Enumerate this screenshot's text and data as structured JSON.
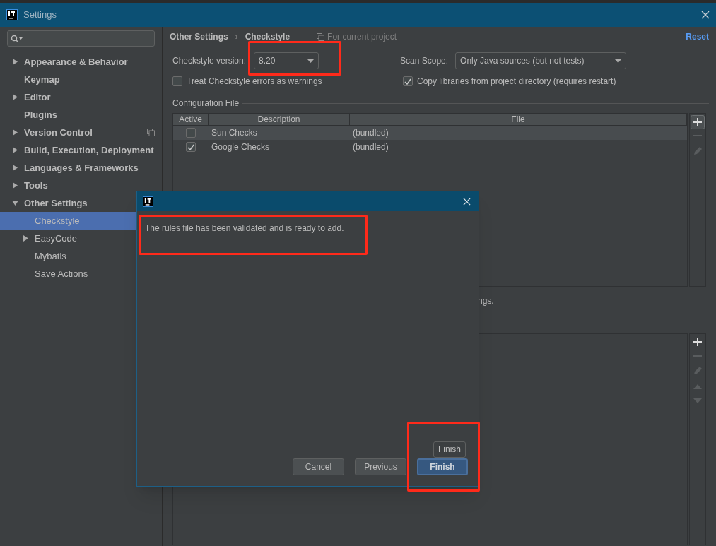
{
  "window": {
    "title": "Settings"
  },
  "sidebar": {
    "items": [
      {
        "label": "Appearance & Behavior",
        "expanded": false,
        "selected": false
      },
      {
        "label": "Keymap",
        "selected": false
      },
      {
        "label": "Editor",
        "expanded": false,
        "selected": false
      },
      {
        "label": "Plugins",
        "selected": false
      },
      {
        "label": "Version Control",
        "expanded": false,
        "selected": false,
        "project_scoped": true
      },
      {
        "label": "Build, Execution, Deployment",
        "expanded": false,
        "selected": false
      },
      {
        "label": "Languages & Frameworks",
        "expanded": false,
        "selected": false
      },
      {
        "label": "Tools",
        "expanded": false,
        "selected": false
      },
      {
        "label": "Other Settings",
        "expanded": true,
        "selected": false,
        "children": [
          {
            "label": "Checkstyle",
            "selected": true
          },
          {
            "label": "EasyCode",
            "expanded": false,
            "selected": false
          },
          {
            "label": "Mybatis",
            "selected": false
          },
          {
            "label": "Save Actions",
            "selected": false
          }
        ]
      }
    ]
  },
  "breadcrumb": [
    "Other Settings",
    "Checkstyle"
  ],
  "breadcrumb_separator": "›",
  "scope_note": "For current project",
  "reset_link": "Reset",
  "version": {
    "label": "Checkstyle version:",
    "value": "8.20",
    "highlighted": true
  },
  "scan_scope": {
    "label": "Scan Scope:",
    "value": "Only Java sources (but not tests)"
  },
  "options": [
    {
      "label": "Treat Checkstyle errors as warnings",
      "checked": false
    },
    {
      "label": "Copy libraries from project directory (requires restart)",
      "checked": true
    }
  ],
  "config_section": "Configuration File",
  "table": {
    "columns": [
      "Active",
      "Description",
      "File"
    ],
    "rows": [
      {
        "active": false,
        "description": "Sun Checks",
        "file": "(bundled)",
        "selected": true
      },
      {
        "active": true,
        "description": "Google Checks",
        "file": "(bundled)",
        "selected": false
      }
    ]
  },
  "covered_text": "ngs.",
  "dialog": {
    "message": "The rules file has been validated and is ready to add.",
    "message_highlighted": true,
    "buttons": [
      {
        "label": "Cancel",
        "default": false,
        "highlighted": false
      },
      {
        "label": "Previous",
        "default": false,
        "highlighted": false
      },
      {
        "label": "Finish",
        "default": true,
        "highlighted": true,
        "tooltip": "Finish"
      }
    ]
  }
}
